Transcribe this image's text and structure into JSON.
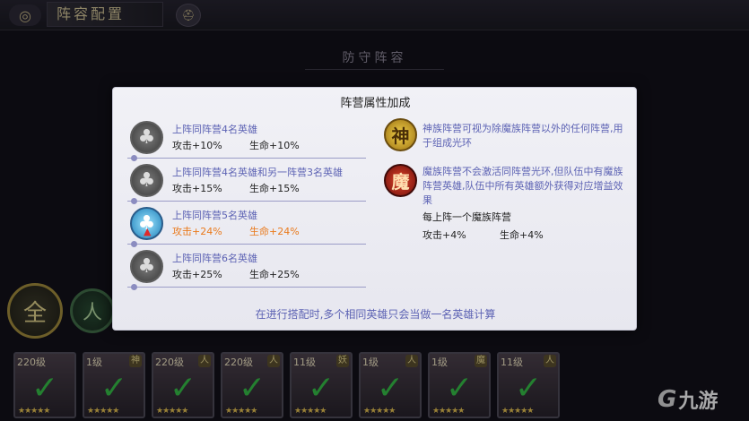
{
  "header": {
    "title": "阵容配置",
    "back_icon": "back-swirl-icon",
    "helm_icon": "helmet-icon"
  },
  "background": {
    "section_title": "防守阵容"
  },
  "factions": [
    {
      "label": "全"
    },
    {
      "label": "人"
    }
  ],
  "heroes": [
    {
      "level": "220级",
      "tag": ""
    },
    {
      "level": "1级",
      "tag": "神"
    },
    {
      "level": "220级",
      "tag": "人"
    },
    {
      "level": "220级",
      "tag": "人"
    },
    {
      "level": "11级",
      "tag": "妖"
    },
    {
      "level": "1级",
      "tag": "人"
    },
    {
      "level": "1级",
      "tag": "魔"
    },
    {
      "level": "11级",
      "tag": "人"
    }
  ],
  "panel": {
    "title": "阵营属性加成",
    "left": [
      {
        "condition": "上阵同阵营4名英雄",
        "attack": "攻击+10%",
        "life": "生命+10%",
        "active": false
      },
      {
        "condition": "上阵同阵营4名英雄和另一阵营3名英雄",
        "attack": "攻击+15%",
        "life": "生命+15%",
        "active": false
      },
      {
        "condition": "上阵同阵营5名英雄",
        "attack": "攻击+24%",
        "life": "生命+24%",
        "active": true
      },
      {
        "condition": "上阵同阵营6名英雄",
        "attack": "攻击+25%",
        "life": "生命+25%",
        "active": false
      }
    ],
    "right": {
      "shen_icon": "神",
      "shen_text": "神族阵营可视为除魔族阵营以外的任何阵营,用于组成光环",
      "mo_icon": "魔",
      "mo_text": "魔族阵营不会激活同阵营光环,但队伍中有魔族阵营英雄,队伍中所有英雄额外获得对应增益效果",
      "per_mo": "每上阵一个魔族阵营",
      "attack": "攻击+4%",
      "life": "生命+4%"
    },
    "footer": "在进行搭配时,多个相同英雄只会当做一名英雄计算"
  },
  "logo": {
    "text": "九游",
    "mark": "G"
  },
  "colors": {
    "accent_text": "#5d63b4",
    "active_bonus": "#ea7a1c",
    "check": "#33c044"
  }
}
